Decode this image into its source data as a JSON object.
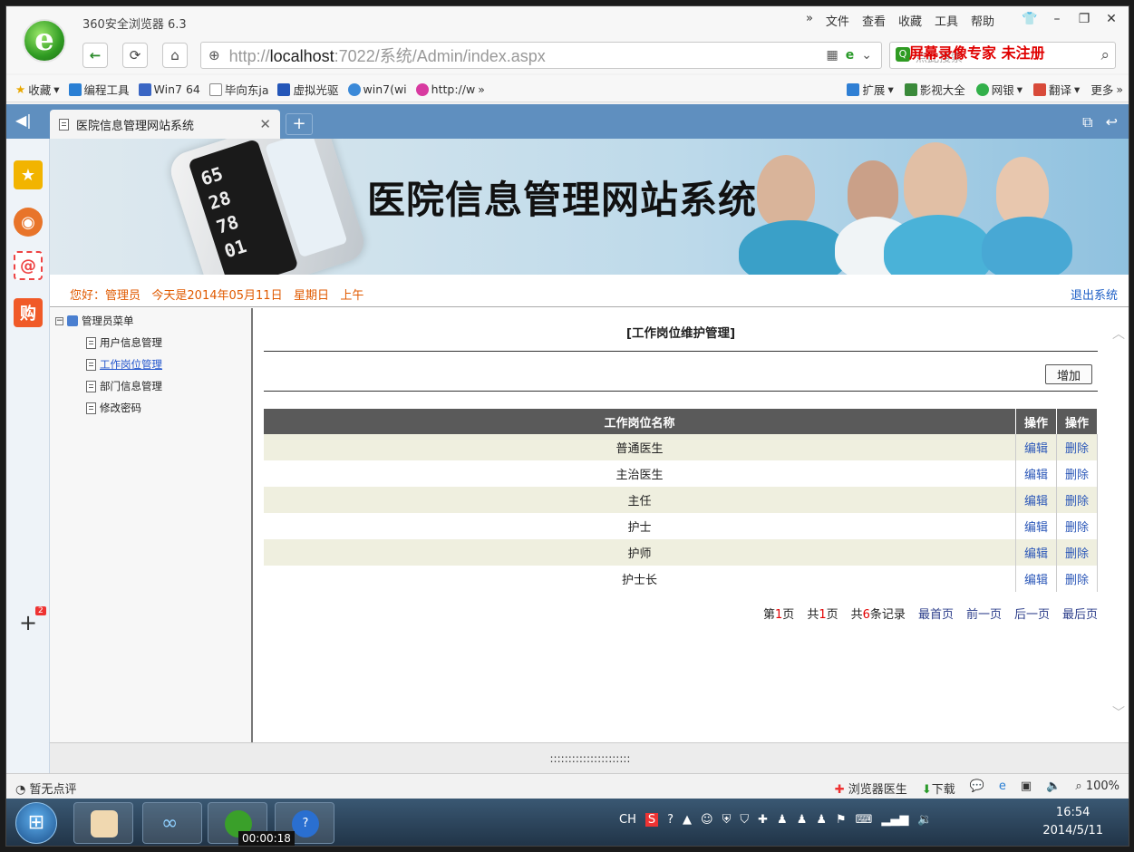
{
  "browser": {
    "title": "360安全浏览器 6.3",
    "menu": [
      "文件",
      "查看",
      "收藏",
      "工具",
      "帮助"
    ],
    "url_prefix": "http://",
    "url_host": "localhost",
    "url_rest": ":7022/系统/Admin/index.aspx",
    "search_placeholder": "点此搜索",
    "watermark": "屏幕录像专家 未注册",
    "bookmarks_left": [
      "收藏",
      "编程工具",
      "Win7 64",
      "毕向东ja",
      "虚拟光驱",
      "win7(wi",
      "http://w"
    ],
    "bookmarks_right": [
      "扩展",
      "影视大全",
      "网银",
      "翻译",
      "更多"
    ],
    "tab_title": "医院信息管理网站系统",
    "status_left": "暂无点评",
    "status_right": [
      "浏览器医生",
      "下载",
      "100%"
    ]
  },
  "page": {
    "banner_title": "医院信息管理网站系统",
    "device_digits": [
      "65",
      "28",
      "78",
      "01"
    ],
    "greeting": "您好：管理员   今天是2014年05月11日   星期日   上午",
    "logout": "退出系统",
    "tree": {
      "root": "管理员菜单",
      "items": [
        "用户信息管理",
        "工作岗位管理",
        "部门信息管理",
        "修改密码"
      ]
    },
    "heading": "[工作岗位维护管理]",
    "add_button": "增加",
    "table": {
      "headers": [
        "工作岗位名称",
        "操作",
        "操作"
      ],
      "rows": [
        "普通医生",
        "主治医生",
        "主任",
        "护士",
        "护师",
        "护士长"
      ],
      "edit": "编辑",
      "delete": "删除"
    },
    "pager": {
      "page_pre": "第",
      "page_num": "1",
      "page_suf": "页",
      "total_pre": "共",
      "total_num": "1",
      "total_suf": "页",
      "rec_pre": "共",
      "rec_num": "6",
      "rec_suf": "条记录",
      "first": "最首页",
      "prev": "前一页",
      "next": "后一页",
      "last": "最后页"
    },
    "splitter": "::::::::::::::::::::::"
  },
  "taskbar": {
    "timer": "00:00:18",
    "tray_lang": "CH",
    "time": "16:54",
    "date": "2014/5/11"
  },
  "colors": {
    "tab_bar": "#5f8fbf",
    "greeting": "#e05a00",
    "link": "#2b57b8",
    "header_bg": "#5a5a5a",
    "row_odd": "#efefdf",
    "pager_red": "#e30000"
  }
}
